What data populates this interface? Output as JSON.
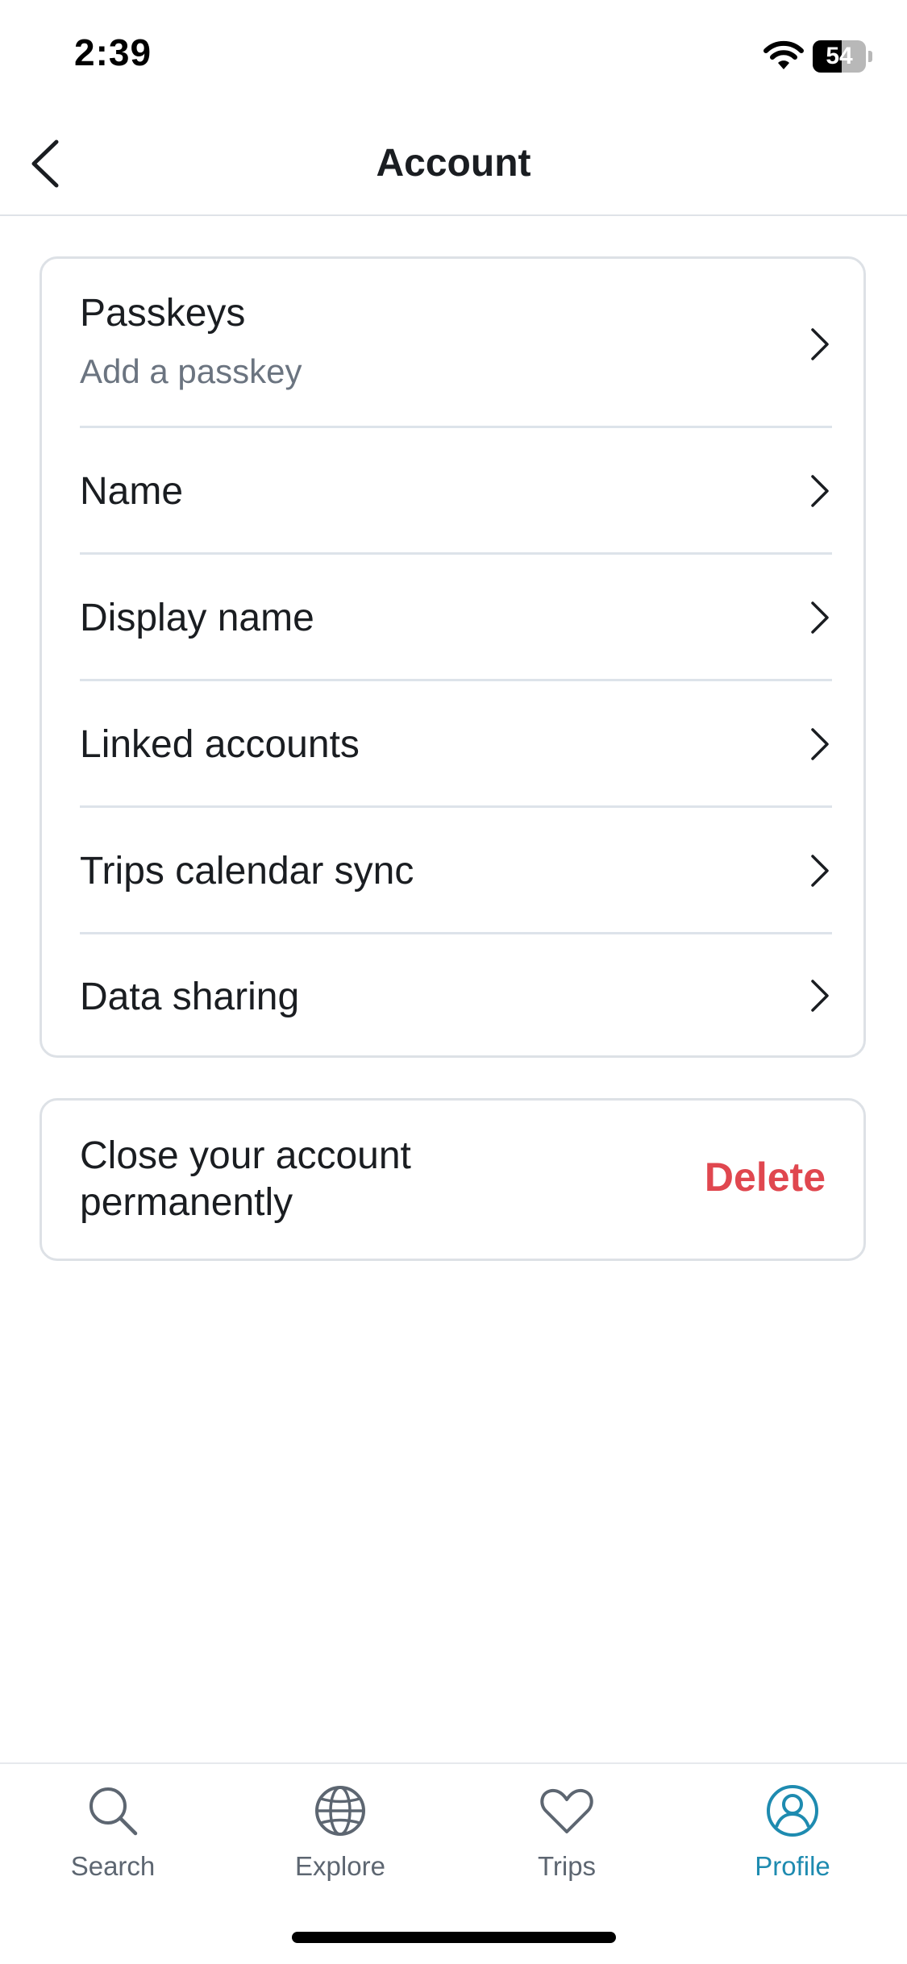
{
  "status_bar": {
    "time": "2:39",
    "battery_level": "54",
    "battery_fraction": 0.54
  },
  "header": {
    "title": "Account",
    "back_icon": "chevron-left-icon"
  },
  "settings": {
    "items": [
      {
        "title": "Passkeys",
        "subtitle": "Add a passkey"
      },
      {
        "title": "Name"
      },
      {
        "title": "Display name"
      },
      {
        "title": "Linked accounts"
      },
      {
        "title": "Trips calendar sync"
      },
      {
        "title": "Data sharing"
      }
    ]
  },
  "close_account": {
    "text": "Close your account permanently",
    "action_label": "Delete",
    "action_color": "#e0474f"
  },
  "tab_bar": {
    "active_color": "#1e8bb0",
    "tabs": [
      {
        "label": "Search",
        "icon": "search-icon"
      },
      {
        "label": "Explore",
        "icon": "globe-icon"
      },
      {
        "label": "Trips",
        "icon": "heart-icon"
      },
      {
        "label": "Profile",
        "icon": "profile-icon",
        "active": true
      }
    ]
  }
}
